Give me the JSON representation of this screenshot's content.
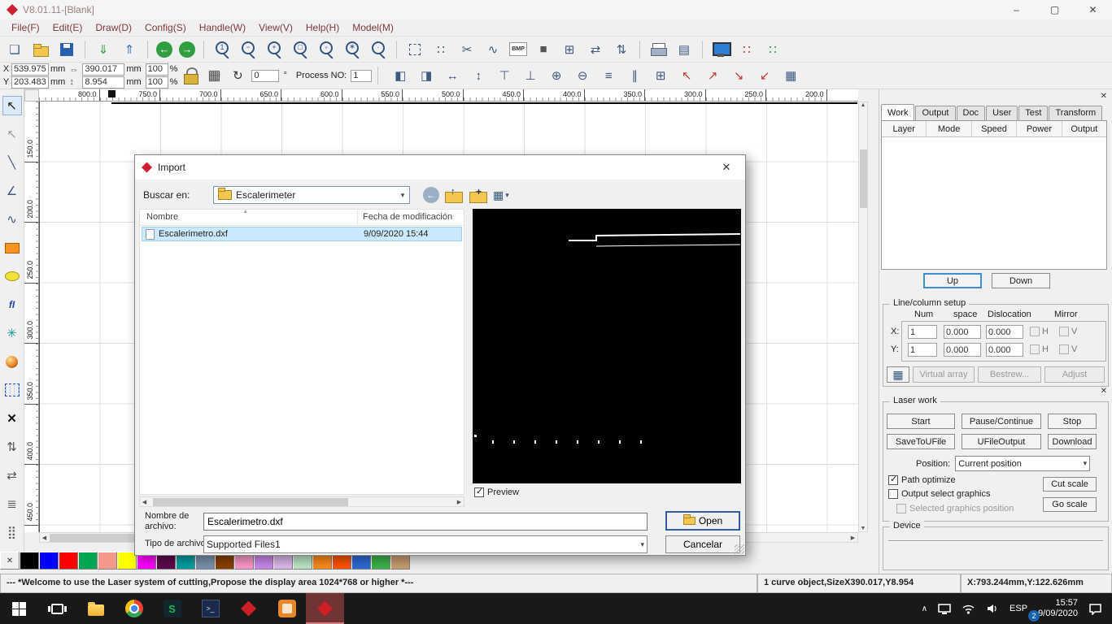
{
  "app": {
    "title": "V8.01.11-[Blank]",
    "window_controls": {
      "minimize": "–",
      "maximize": "▢",
      "close": "✕"
    },
    "menu": [
      {
        "label": "File(F)",
        "n": "menu-file"
      },
      {
        "label": "Edit(E)",
        "n": "menu-edit"
      },
      {
        "label": "Draw(D)",
        "n": "menu-draw"
      },
      {
        "label": "Config(S)",
        "n": "menu-config"
      },
      {
        "label": "Handle(W)",
        "n": "menu-handle"
      },
      {
        "label": "View(V)",
        "n": "menu-view"
      },
      {
        "label": "Help(H)",
        "n": "menu-help"
      },
      {
        "label": "Model(M)",
        "n": "menu-model"
      }
    ]
  },
  "toolbar_main": {
    "icons": [
      {
        "n": "new-icon",
        "g": "❏",
        "c": "ic k",
        "i": "true"
      },
      {
        "n": "open-folder-icon",
        "g": "",
        "c": "ic fold",
        "i": "true"
      },
      {
        "n": "save-icon",
        "g": "",
        "c": "ic floppy",
        "i": "true"
      },
      {
        "n": "separator",
        "g": "",
        "c": "ic sep",
        "i": "false"
      },
      {
        "n": "import-icon",
        "g": "⇓",
        "c": "ic green",
        "i": "true"
      },
      {
        "n": "export-icon",
        "g": "⇑",
        "c": "ic blue",
        "i": "true"
      },
      {
        "n": "separator",
        "g": "",
        "c": "ic sep",
        "i": "false"
      },
      {
        "n": "back-icon",
        "g": "←",
        "c": "ic circ",
        "i": "true"
      },
      {
        "n": "forward-icon",
        "g": "→",
        "c": "ic circ",
        "i": "true"
      },
      {
        "n": "separator",
        "g": "",
        "c": "ic sep",
        "i": "false"
      },
      {
        "n": "zoom-reset-icon",
        "g": "1",
        "c": "ic zoom",
        "i": "true"
      },
      {
        "n": "zoom-out-icon",
        "g": "−",
        "c": "ic zoom",
        "i": "true"
      },
      {
        "n": "zoom-in-icon",
        "g": "+",
        "c": "ic zoom",
        "i": "true"
      },
      {
        "n": "zoom-window-icon",
        "g": "□",
        "c": "ic zoom",
        "i": "true"
      },
      {
        "n": "zoom-page-icon",
        "g": "▫",
        "c": "ic zoom",
        "i": "true"
      },
      {
        "n": "zoom-all-icon",
        "g": "∗",
        "c": "ic zoom",
        "i": "true"
      },
      {
        "n": "zoom-select-icon",
        "g": "·",
        "c": "ic zoom",
        "i": "true"
      },
      {
        "n": "separator",
        "g": "",
        "c": "ic sep",
        "i": "false"
      },
      {
        "n": "marquee-icon",
        "g": "",
        "c": "ic marquee",
        "i": "true"
      },
      {
        "n": "pick-point-icon",
        "g": "∷",
        "c": "ic k",
        "i": "true"
      },
      {
        "n": "knife-icon",
        "g": "✂",
        "c": "ic k",
        "i": "true"
      },
      {
        "n": "curve-icon",
        "g": "∿",
        "c": "ic k",
        "i": "true"
      },
      {
        "n": "bmp-icon",
        "g": "BMP",
        "c": "ic bmp",
        "i": "true"
      },
      {
        "n": "fill-icon",
        "g": "■",
        "c": "ic dark",
        "i": "true"
      },
      {
        "n": "hierarchy-icon",
        "g": "⊞",
        "c": "ic k",
        "i": "true"
      },
      {
        "n": "kern-h-icon",
        "g": "⇄",
        "c": "ic k",
        "i": "true"
      },
      {
        "n": "kern-v-icon",
        "g": "⇅",
        "c": "ic k",
        "i": "true"
      },
      {
        "n": "separator",
        "g": "",
        "c": "ic sep",
        "i": "false"
      },
      {
        "n": "print-icon",
        "g": "",
        "c": "ic printer",
        "i": "true"
      },
      {
        "n": "datasheet-icon",
        "g": "▤",
        "c": "ic k",
        "i": "true"
      },
      {
        "n": "separator",
        "g": "",
        "c": "ic sep",
        "i": "false"
      },
      {
        "n": "monitor-icon",
        "g": "",
        "c": "ic monitor",
        "i": "true"
      },
      {
        "n": "array-output-icon",
        "g": "∷",
        "c": "ic red",
        "i": "true"
      },
      {
        "n": "array-preview-icon",
        "g": "∷",
        "c": "ic green",
        "i": "true"
      }
    ]
  },
  "toolbar_props": {
    "x_label": "X",
    "x_value": "539.975",
    "x_unit": "mm",
    "y_label": "Y",
    "y_value": "203.483",
    "y_unit": "mm",
    "link_h": "⇔",
    "link_v": "↕",
    "w_value": "390.017",
    "w_unit": "mm",
    "h_value": "8.954",
    "h_unit": "mm",
    "scale_x": "100",
    "scale_y": "100",
    "percent": "%",
    "rotate_value": "0",
    "degree": "°",
    "process_label": "Process NO:",
    "process_value": "1",
    "icons": [
      {
        "n": "datum-left-icon",
        "g": "◧",
        "c": "ic k",
        "i": "true"
      },
      {
        "n": "datum-right-icon",
        "g": "◨",
        "c": "ic k",
        "i": "true"
      },
      {
        "n": "fit-width-icon",
        "g": "↔",
        "c": "ic k",
        "i": "true"
      },
      {
        "n": "fit-height-icon",
        "g": "↕",
        "c": "ic k",
        "i": "true"
      },
      {
        "n": "char-top-icon",
        "g": "⊤",
        "c": "ic k",
        "i": "true"
      },
      {
        "n": "char-bottom-icon",
        "g": "⊥",
        "c": "ic k",
        "i": "true"
      },
      {
        "n": "weld-icon",
        "g": "⊕",
        "c": "ic k",
        "i": "true"
      },
      {
        "n": "trim-icon",
        "g": "⊖",
        "c": "ic k",
        "i": "true"
      },
      {
        "n": "h-align-icon",
        "g": "≡",
        "c": "ic k",
        "i": "true"
      },
      {
        "n": "v-align-icon",
        "g": "∥",
        "c": "ic k",
        "i": "true"
      },
      {
        "n": "grid-align-icon",
        "g": "⊞",
        "c": "ic k",
        "i": "true"
      },
      {
        "n": "corner-up-left-icon",
        "g": "↖",
        "c": "ic red",
        "i": "true"
      },
      {
        "n": "corner-up-right-icon",
        "g": "↗",
        "c": "ic red",
        "i": "true"
      },
      {
        "n": "corner-down-right-icon",
        "g": "↘",
        "c": "ic red",
        "i": "true"
      },
      {
        "n": "corner-down-left-icon",
        "g": "↙",
        "c": "ic red",
        "i": "true"
      },
      {
        "n": "table-icon",
        "g": "▦",
        "c": "ic k",
        "i": "true"
      }
    ]
  },
  "tools_left": {
    "icons": [
      {
        "n": "select-tool-icon",
        "g": "↖",
        "c": "lt active",
        "i": "true"
      },
      {
        "n": "node-edit-tool-icon",
        "g": "↖",
        "c": "lt gray",
        "i": "true"
      },
      {
        "n": "line-tool-icon",
        "g": "╲",
        "c": "lt",
        "i": "true"
      },
      {
        "n": "polyline-tool-icon",
        "g": "∠",
        "c": "lt",
        "i": "true"
      },
      {
        "n": "curve-tool-icon",
        "g": "∿",
        "c": "lt",
        "i": "true"
      },
      {
        "n": "rect-tool-icon",
        "g": "",
        "c": "lt sh-rect",
        "i": "true"
      },
      {
        "n": "ellipse-tool-icon",
        "g": "",
        "c": "lt sh-ellipse",
        "i": "true"
      },
      {
        "n": "text-tool-icon",
        "g": "fI",
        "c": "lt text",
        "i": "true"
      },
      {
        "n": "star-tool-icon",
        "g": "✳",
        "c": "lt teal",
        "i": "true"
      },
      {
        "n": "sphere-tool-icon",
        "g": "",
        "c": "lt sh-sphere",
        "i": "true"
      },
      {
        "n": "array-tool-icon",
        "g": "",
        "c": "lt sh-grid",
        "i": "true"
      },
      {
        "n": "delete-tool-icon",
        "g": "✕",
        "c": "lt black",
        "i": "true"
      },
      {
        "n": "mirror-v-tool-icon",
        "g": "⇅",
        "c": "lt dkgray",
        "i": "true"
      },
      {
        "n": "mirror-h-tool-icon",
        "g": "⇄",
        "c": "lt dkgray",
        "i": "true"
      },
      {
        "n": "offset-tool-icon",
        "g": "≣",
        "c": "lt dkgray",
        "i": "true"
      },
      {
        "n": "matrix-tool-icon",
        "g": "⣿",
        "c": "lt dkgray",
        "i": "true"
      }
    ]
  },
  "rulers": {
    "h": [
      "800.0",
      "750.0",
      "700.0",
      "650.0",
      "600.0",
      "550.0",
      "500.0",
      "450.0",
      "400.0",
      "350.0",
      "300.0",
      "250.0",
      "200.0"
    ],
    "v": [
      "150.0",
      "200.0",
      "250.0",
      "300.0",
      "350.0",
      "400.0",
      "450.0"
    ]
  },
  "palette": {
    "none_glyph": "✕",
    "colors": [
      "#000000",
      "#0000ff",
      "#ff0000",
      "#00a651",
      "#f4998a",
      "#ffff00",
      "#ff00ff",
      "#5e0b4c",
      "#00a0a0",
      "#7b93af",
      "#8b4000",
      "#ff99cc",
      "#cc88ee",
      "#ddbbee",
      "#bfe9c8",
      "#ff8c1a",
      "#ff5500",
      "#2e6bd6",
      "#3cb54a",
      "#c8a06e"
    ]
  },
  "dialog": {
    "title": "Import",
    "close_glyph": "✕",
    "look_in_label": "Buscar en:",
    "look_in_value": "Escalerimeter",
    "columns": [
      "Nombre",
      "Fecha de modificación"
    ],
    "files": [
      {
        "name": "Escalerimetro.dxf",
        "modified": "9/09/2020 15:44"
      }
    ],
    "preview_label": "Preview",
    "filename_label_1": "Nombre de",
    "filename_label_2": "archivo:",
    "filename_value": "Escalerimetro.dxf",
    "filetype_label": "Tipo de archivo:",
    "filetype_value": "Supported Files1",
    "open_label": "Open",
    "cancel_label": "Cancelar"
  },
  "right_panel": {
    "tabs": [
      {
        "label": "Work",
        "n": "tab-work"
      },
      {
        "label": "Output",
        "n": "tab-output"
      },
      {
        "label": "Doc",
        "n": "tab-doc"
      },
      {
        "label": "User",
        "n": "tab-user"
      },
      {
        "label": "Test",
        "n": "tab-test"
      },
      {
        "label": "Transform",
        "n": "tab-transform"
      }
    ],
    "table_columns": [
      "Layer",
      "Mode",
      "Speed",
      "Power",
      "Output"
    ],
    "up_label": "Up",
    "down_label": "Down",
    "line_column": {
      "title": "Line/column setup",
      "col_num": "Num",
      "col_space": "space",
      "col_dislocation": "Dislocation",
      "col_mirror": "Mirror",
      "x_label": "X:",
      "y_label": "Y:",
      "x_num": "1",
      "x_space": "0.000",
      "x_dislocation": "0.000",
      "y_num": "1",
      "y_space": "0.000",
      "y_dislocation": "0.000",
      "h_label": "H",
      "v_label": "V",
      "virtual_array": "Virtual array",
      "bestrew": "Bestrew...",
      "adjust": "Adjust"
    },
    "laser_work": {
      "title": "Laser work",
      "row1": [
        {
          "label": "Start",
          "n": "start-button"
        },
        {
          "label": "Pause/Continue",
          "n": "pause-continue-button"
        },
        {
          "label": "Stop",
          "n": "stop-button"
        }
      ],
      "row2": [
        {
          "label": "SaveToUFile",
          "n": "save-to-ufile-button"
        },
        {
          "label": "UFileOutput",
          "n": "ufile-output-button"
        },
        {
          "label": "Download",
          "n": "download-button"
        }
      ],
      "position_label": "Position:",
      "position_value": "Current position",
      "opt_path": "Path optimize",
      "opt_output": "Output select graphics",
      "opt_selected": "Selected graphics position",
      "cut_scale": "Cut scale",
      "go_scale": "Go scale"
    },
    "device": {
      "title": "Device"
    }
  },
  "statusbar": {
    "message": "--- *Welcome to use the Laser system of cutting,Propose the display area 1024*768 or higher *---",
    "object_info": "1 curve object,SizeX390.017,Y8.954",
    "coords": "X:793.244mm,Y:122.626mm"
  },
  "taskbar": {
    "app_icons": [
      "start",
      "task-view",
      "file-explorer",
      "chrome",
      "capture-app",
      "terminal",
      "laser-app",
      "office-app",
      "laser-app-active"
    ],
    "lang": "ESP",
    "time": "15:57",
    "date": "9/09/2020",
    "badge": "2",
    "chevron": "∧"
  }
}
